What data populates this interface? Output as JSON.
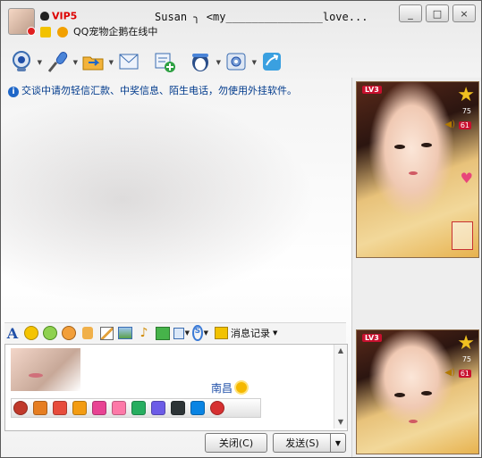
{
  "title_bar": {
    "vip_label": "VIP5",
    "contact_name": "Susan ╮ <my_______________love...",
    "status_line": "QQ宠物企鹅在线中",
    "window_buttons": [
      "_",
      "□",
      "×"
    ]
  },
  "toolbar": {
    "items": [
      {
        "name": "video-call",
        "icon": "webcam-icon",
        "has_dropdown": true
      },
      {
        "name": "voice-call",
        "icon": "microphone-icon",
        "has_dropdown": true
      },
      {
        "name": "send-file",
        "icon": "folder-icon",
        "has_dropdown": true
      },
      {
        "name": "send-mail",
        "icon": "mail-icon",
        "has_dropdown": false
      },
      {
        "name": "create-group",
        "icon": "group-add-icon",
        "has_dropdown": false
      },
      {
        "name": "app-menu",
        "icon": "penguin-icon",
        "has_dropdown": true
      },
      {
        "name": "settings",
        "icon": "gear-icon",
        "has_dropdown": true
      },
      {
        "name": "remote-assist",
        "icon": "remote-icon",
        "has_dropdown": false
      }
    ]
  },
  "notice": {
    "text": "交谈中请勿轻信汇款、中奖信息、陌生电话，勿使用外挂软件。"
  },
  "format_bar": {
    "font_label": "A",
    "history_label": "消息记录"
  },
  "input_area": {
    "sender_label": "南昌"
  },
  "buttons": {
    "close": "关闭(C)",
    "send": "发送(S)",
    "send_dropdown": "▼"
  },
  "profile_cards": [
    {
      "level": "LV3",
      "score": "75",
      "badge": "61"
    },
    {
      "level": "LV3",
      "score": "75",
      "badge": "61"
    }
  ],
  "colors": {
    "accent": "#1f4fa8",
    "notice_text": "#003a8c",
    "vip": "#dd0000"
  }
}
